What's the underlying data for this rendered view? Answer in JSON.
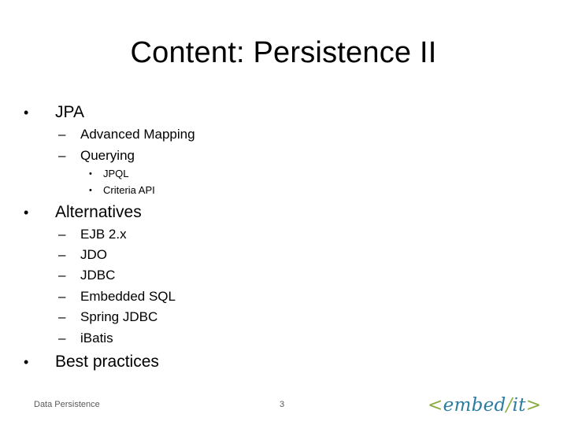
{
  "slide": {
    "title": "Content: Persistence II",
    "bullets": [
      {
        "label": "JPA",
        "children": [
          {
            "label": "Advanced Mapping"
          },
          {
            "label": "Querying",
            "children": [
              {
                "label": "JPQL"
              },
              {
                "label": "Criteria API"
              }
            ]
          }
        ]
      },
      {
        "label": "Alternatives",
        "children": [
          {
            "label": "EJB 2.x"
          },
          {
            "label": "JDO"
          },
          {
            "label": "JDBC"
          },
          {
            "label": "Embedded SQL"
          },
          {
            "label": "Spring JDBC"
          },
          {
            "label": "iBatis"
          }
        ]
      },
      {
        "label": "Best practices"
      }
    ],
    "bullet_glyph_l1": "•",
    "bullet_glyph_l2": "–",
    "bullet_glyph_l3": "•"
  },
  "footer": {
    "left_text": "Data Persistence",
    "page_number": "3"
  },
  "logo": {
    "open_bracket": "<",
    "part1": "embed",
    "slash": "/",
    "part2": "it",
    "close_bracket": ">",
    "colors": {
      "accent_green": "#8aac3c",
      "brand_blue": "#2a7ca0"
    }
  }
}
